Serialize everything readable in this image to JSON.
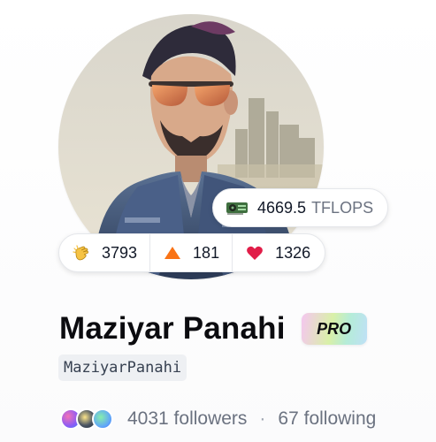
{
  "compute": {
    "value": "4669.5",
    "unit": "TFLOPS",
    "icon": "gpu-icon"
  },
  "reactions": [
    {
      "icon": "clap-icon",
      "count": "3793"
    },
    {
      "icon": "upvote-triangle-icon",
      "count": "181"
    },
    {
      "icon": "heart-icon",
      "count": "1326"
    }
  ],
  "profile": {
    "name": "Maziyar Panahi",
    "badge": "PRO",
    "username": "MaziyarPanahi"
  },
  "social": {
    "followers": "4031 followers",
    "separator": "·",
    "following": "67 following"
  },
  "colors": {
    "heart": "#e11d48",
    "upvote": "#f97316",
    "clap": "#f6c344",
    "pro_gradient": [
      "#f5c6f0",
      "#d9f0a8",
      "#b5ecd8",
      "#bfe0f7"
    ]
  }
}
